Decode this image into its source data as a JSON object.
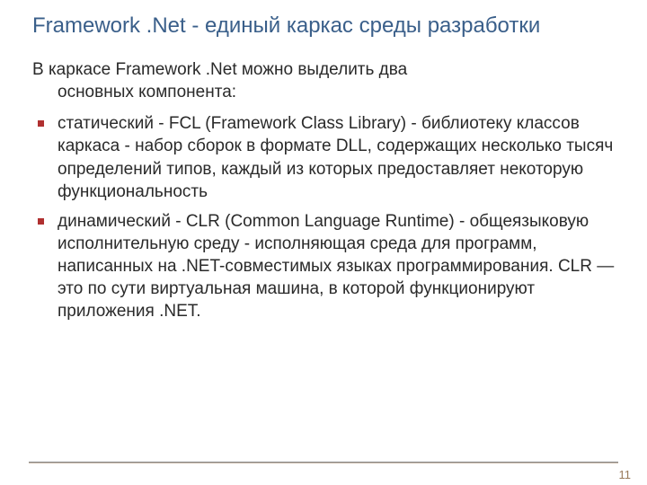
{
  "title": "Framework .Net - единый каркас среды разработки",
  "intro_line1": "В каркасе Framework .Net можно выделить два",
  "intro_line2": "основных компонента:",
  "bullets": [
    "статический - FCL (Framework Class Library) - библиотеку классов каркаса - набор сборок в формате DLL, содержащих несколько тысяч определений типов, каждый из которых предоставляет некоторую функциональность",
    "динамический - CLR (Common Language Runtime) - общеязыковую исполнительную среду - исполняющая среда для программ, написанных на .NET-совместимых языках программирования. CLR — это по сути виртуальная машина, в которой функционируют приложения .NET."
  ],
  "page_number": "11"
}
